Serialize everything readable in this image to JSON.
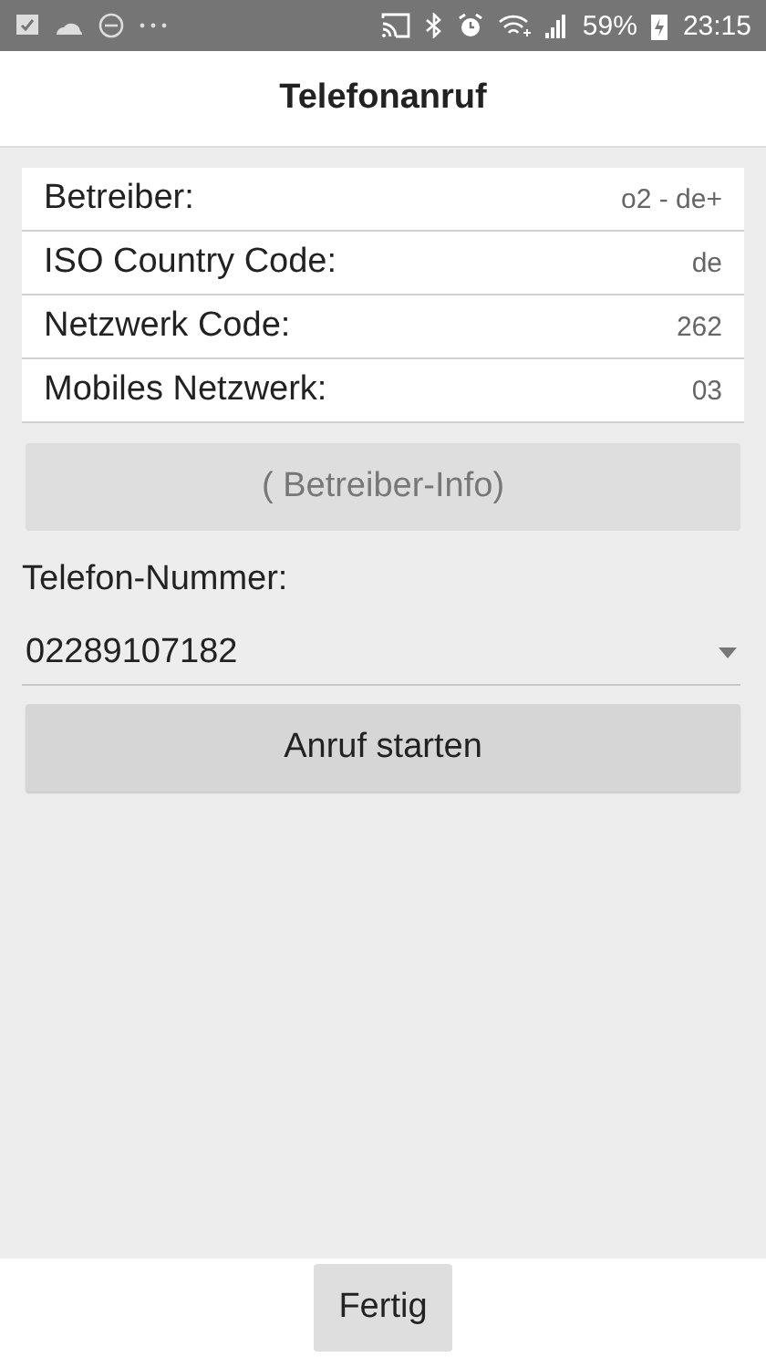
{
  "status_bar": {
    "battery": "59%",
    "time": "23:15"
  },
  "header": {
    "title": "Telefonanruf"
  },
  "info_rows": [
    {
      "label": "Betreiber:",
      "value": "o2 - de+"
    },
    {
      "label": "ISO Country Code:",
      "value": "de"
    },
    {
      "label": "Netzwerk Code:",
      "value": "262"
    },
    {
      "label": "Mobiles Netzwerk:",
      "value": "03"
    }
  ],
  "info_button": {
    "label": "( Betreiber-Info)",
    "disabled": true
  },
  "phone": {
    "label": "Telefon-Nummer:",
    "value": "02289107182"
  },
  "call_button": {
    "label": "Anruf starten",
    "disabled": false
  },
  "footer": {
    "button": "Fertig"
  }
}
